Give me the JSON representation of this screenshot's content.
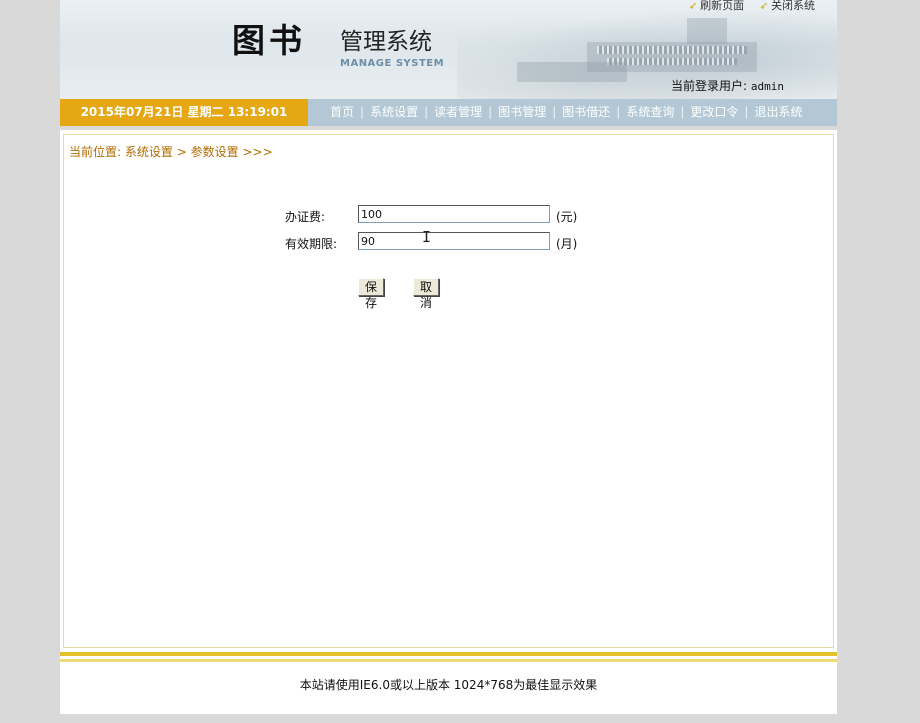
{
  "header": {
    "title_big": "图书",
    "title_small": "管理系统",
    "title_en": "MANAGE SYSTEM",
    "links": {
      "refresh": "刷新页面",
      "close": "关闭系统"
    },
    "user_label": "当前登录用户:",
    "user_name": "admin"
  },
  "navbar": {
    "datetime": "2015年07月21日 星期二 13:19:01",
    "items": {
      "home": "首页",
      "system_settings": "系统设置",
      "reader_mgmt": "读者管理",
      "book_mgmt": "图书管理",
      "borrow_return": "图书借还",
      "system_query": "系统查询",
      "change_password": "更改口令",
      "logout": "退出系统"
    },
    "separator": "|"
  },
  "breadcrumb": {
    "prefix": "当前位置:",
    "level1": "系统设置",
    "arrow": ">",
    "level2": "参数设置",
    "suffix": ">>>"
  },
  "form": {
    "fee": {
      "label": "办证费:",
      "value": "100",
      "unit": "(元)"
    },
    "validity": {
      "label": "有效期限:",
      "value": "90",
      "unit": "(月)"
    },
    "save_label": "保存",
    "cancel_label": "取消"
  },
  "footer": {
    "text": "本站请使用IE6.0或以上版本 1024*768为最佳显示效果"
  },
  "colors": {
    "nav_bg": "#b3c8d4",
    "date_bg": "#e5a713",
    "breadcrumb": "#b26a00",
    "footer_line": "#e3c12b"
  }
}
